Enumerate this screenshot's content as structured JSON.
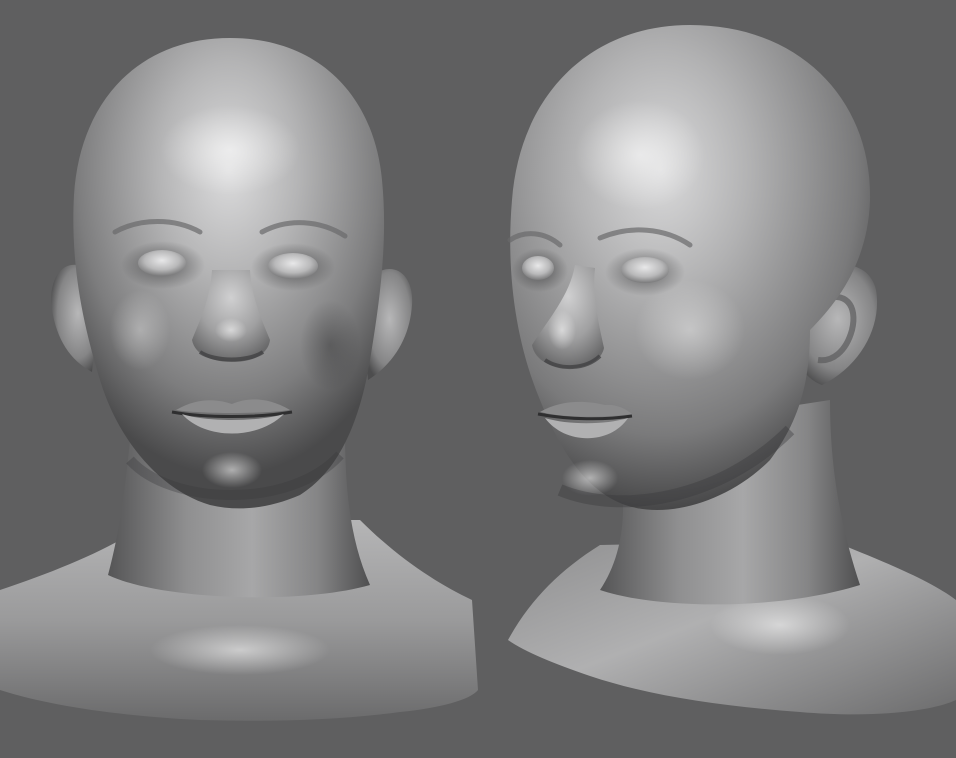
{
  "scene": {
    "background_color": "#5f5f60",
    "material_color": "#9a9a9b",
    "highlight_color": "#d6d6d7",
    "shadow_color": "#2e2e2f",
    "views": [
      {
        "id": "front",
        "subject": "sculpted-head-bust-front-view"
      },
      {
        "id": "three-quarter",
        "subject": "sculpted-head-bust-three-quarter-view"
      }
    ]
  }
}
